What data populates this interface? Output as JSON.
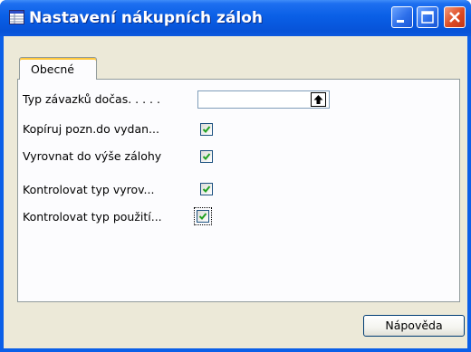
{
  "window": {
    "title": "Nastavení nákupních záloh"
  },
  "tabs": [
    {
      "label": "Obecné",
      "active": true
    }
  ],
  "fields": {
    "typ_zavazku": {
      "label": "Typ závazků dočas. . . . .",
      "value": ""
    },
    "kopiruj_pozn": {
      "label": "Kopíruj pozn.do vydan...",
      "checked": true
    },
    "vyrovnat": {
      "label": "Vyrovnat do výše zálohy",
      "checked": true
    },
    "kontrolovat_vyrov": {
      "label": "Kontrolovat typ vyrov...",
      "checked": true
    },
    "kontrolovat_pouziti": {
      "label": "Kontrolovat typ použití...",
      "checked": true,
      "focused": true
    }
  },
  "buttons": {
    "help_label": "Nápověda"
  },
  "colors": {
    "titlebar": "#0a5fe6",
    "client": "#ece9d8",
    "panel": "#fcfcfe",
    "checkmark": "#21a121",
    "close_button": "#dd4b22"
  },
  "icons": {
    "app": "table-form-icon",
    "dropdown": "lookup-arrow-icon",
    "check": "checkmark-icon"
  }
}
